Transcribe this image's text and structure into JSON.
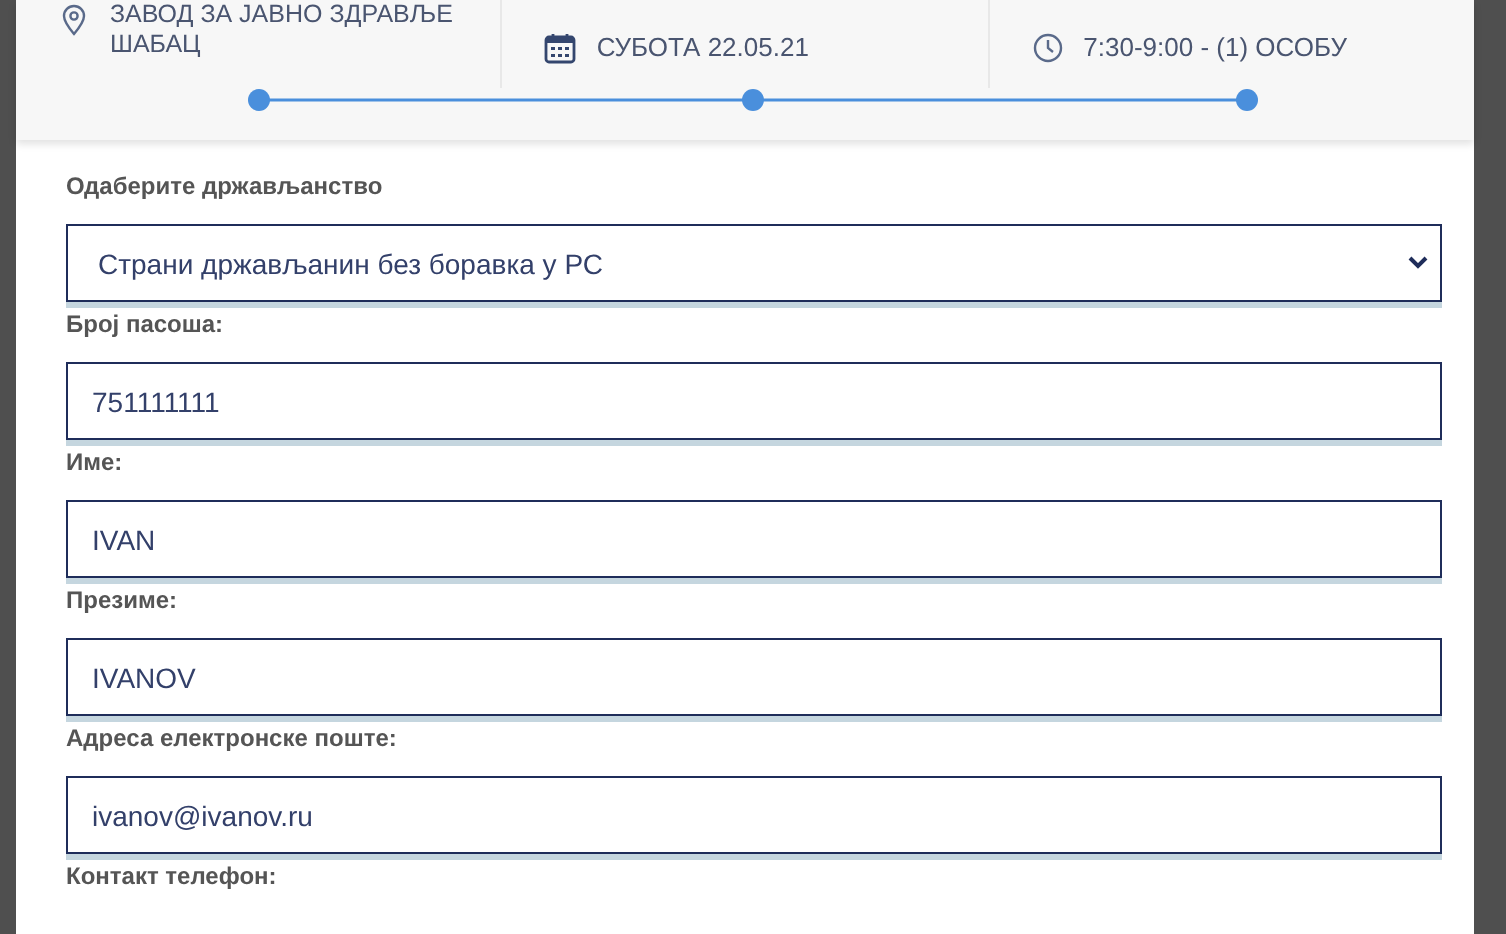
{
  "summary": [
    {
      "kind": "location",
      "lines": [
        "ЗАВОД ЗА ЈАВНО ЗДРАВЉЕ",
        "ШАБАЦ"
      ]
    },
    {
      "kind": "date",
      "lines": [
        "СУБОТА 22.05.21"
      ]
    },
    {
      "kind": "time",
      "lines": [
        "7:30-9:00 - (1) ОСОБУ"
      ]
    }
  ],
  "form": [
    {
      "kind": "select",
      "label": "Одаберите држављанство",
      "value": "Страни држављанин без боравка у РС"
    },
    {
      "kind": "input",
      "label": "Број пасоша:",
      "value": "751111111"
    },
    {
      "kind": "input",
      "label": "Име:",
      "value": "IVAN"
    },
    {
      "kind": "input",
      "label": "Презиме:",
      "value": "IVANOV"
    },
    {
      "kind": "input",
      "label": "Адреса електронске поште:",
      "value": "ivanov@ivanov.ru"
    },
    {
      "kind": "label",
      "label": "Контакт телефон:"
    }
  ]
}
